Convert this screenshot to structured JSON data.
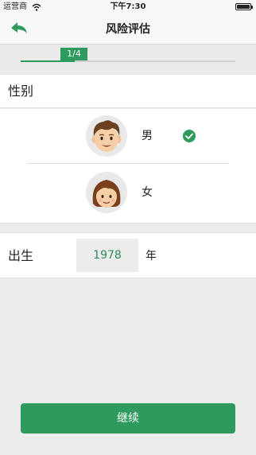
{
  "status_bar": {
    "carrier": "运营商",
    "time": "下午7:30"
  },
  "nav": {
    "title": "风险评估",
    "back_icon": "back-arrow-icon"
  },
  "progress": {
    "label": "1/4",
    "fraction": 0.25,
    "color": "#2e9a5e"
  },
  "gender": {
    "title": "性别",
    "options": [
      {
        "label": "男",
        "icon": "male-avatar-icon",
        "selected": true
      },
      {
        "label": "女",
        "icon": "female-avatar-icon",
        "selected": false
      }
    ]
  },
  "birth": {
    "label": "出生",
    "year": "1978",
    "unit": "年"
  },
  "continue_label": "继续",
  "accent_color": "#2e9a5e"
}
